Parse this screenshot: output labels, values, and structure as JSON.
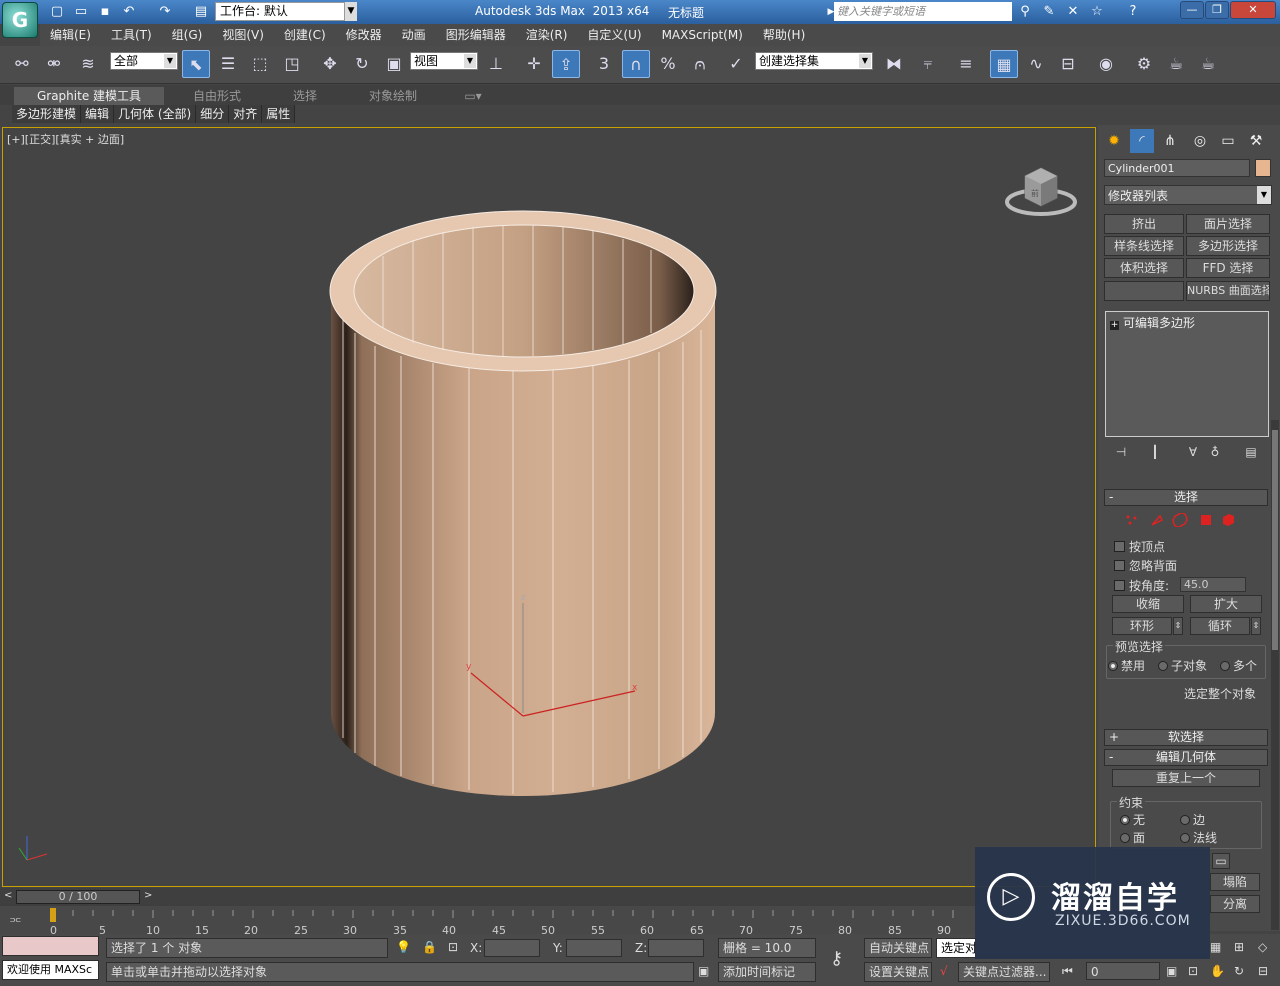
{
  "titlebar": {
    "app_logo": "G",
    "workspace_label": "工作台: 默认",
    "app_title": "Autodesk 3ds Max  2013 x64",
    "doc_title": "无标题",
    "search_placeholder": "键入关键字或短语",
    "help_label": "?"
  },
  "menu": [
    "编辑(E)",
    "工具(T)",
    "组(G)",
    "视图(V)",
    "创建(C)",
    "修改器",
    "动画",
    "图形编辑器",
    "渲染(R)",
    "自定义(U)",
    "MAXScript(M)",
    "帮助(H)"
  ],
  "toolbar": {
    "selection_filter": "全部",
    "ref_coord": "视图",
    "named_selection": "创建选择集",
    "snap_3": "3",
    "percent": "%"
  },
  "ribbon": {
    "tabs": [
      "Graphite 建模工具",
      "自由形式",
      "选择",
      "对象绘制"
    ],
    "subtabs": [
      "多边形建模",
      "编辑",
      "几何体 (全部)",
      "细分",
      "对齐",
      "属性"
    ]
  },
  "viewport": {
    "label": "[+][正交][真实 + 边面]",
    "cube_face": "前",
    "gizmo_x": "x",
    "gizmo_y": "y",
    "gizmo_z": "z"
  },
  "command_panel": {
    "object_name": "Cylinder001",
    "object_color": "#e8b591",
    "modifier_list": "修改器列表",
    "modifier_buttons": [
      "挤出",
      "面片选择",
      "样条线选择",
      "多边形选择",
      "体积选择",
      "FFD 选择",
      "",
      "NURBS 曲面选择"
    ],
    "stack_item": "可编辑多边形",
    "selection": {
      "title": "选择",
      "by_vertex": "按顶点",
      "ignore_backfacing": "忽略背面",
      "by_angle": "按角度:",
      "angle_value": "45.0",
      "shrink": "收缩",
      "grow": "扩大",
      "ring": "环形",
      "loop": "循环",
      "preview_title": "预览选择",
      "preview_options": [
        "禁用",
        "子对象",
        "多个"
      ],
      "select_whole": "选定整个对象"
    },
    "soft_selection": "软选择",
    "edit_geometry": {
      "title": "编辑几何体",
      "repeat_last": "重复上一个",
      "constraints_title": "约束",
      "constraints": [
        "无",
        "边",
        "面",
        "法线"
      ],
      "collapse": "塌陷",
      "detach": "分离"
    }
  },
  "timeline": {
    "frame_display": "0 / 100",
    "ticks": [
      "0",
      "5",
      "10",
      "15",
      "20",
      "25",
      "30",
      "35",
      "40",
      "45",
      "50",
      "55",
      "60",
      "65",
      "70",
      "75",
      "80",
      "85",
      "90"
    ]
  },
  "status": {
    "maxscript_label": "欢迎使用 MAXSc",
    "selection_info": "选择了 1 个 对象",
    "prompt": "单击或单击并拖动以选择对象",
    "x_label": "X:",
    "y_label": "Y:",
    "z_label": "Z:",
    "grid": "栅格 = 10.0",
    "add_time_tag": "添加时间标记",
    "auto_key": "自动关键点",
    "selected_label": "选定对",
    "set_key": "设置关键点",
    "key_filters": "关键点过滤器...",
    "frame_value": "0"
  },
  "watermark": {
    "title": "溜溜自学",
    "subtitle": "ZIXUE.3D66.COM"
  }
}
